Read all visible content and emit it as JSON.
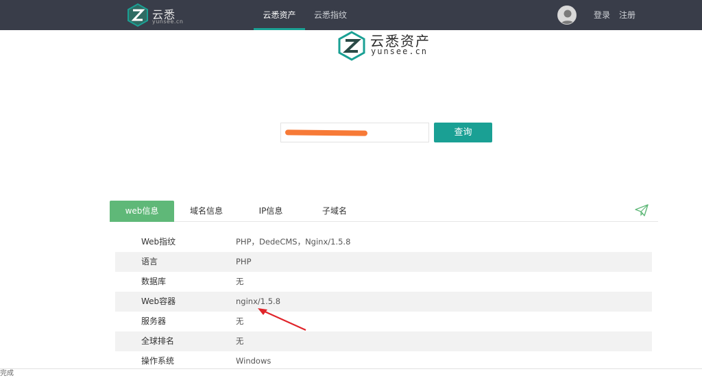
{
  "header": {
    "brand_cn": "云悉",
    "brand_en": "yunsee.cn",
    "nav": [
      {
        "label": "云悉资产",
        "active": true
      },
      {
        "label": "云悉指纹",
        "active": false
      }
    ],
    "login": "登录",
    "register": "注册"
  },
  "logo": {
    "cn": "云悉资产",
    "en": "yunsee.cn"
  },
  "search": {
    "value": "",
    "button": "查询"
  },
  "tabs": [
    {
      "label": "web信息",
      "active": true
    },
    {
      "label": "域名信息",
      "active": false
    },
    {
      "label": "IP信息",
      "active": false
    },
    {
      "label": "子域名",
      "active": false
    }
  ],
  "info_rows": [
    {
      "key": "Web指纹",
      "value": "PHP，DedeCMS，Nginx/1.5.8"
    },
    {
      "key": "语言",
      "value": "PHP"
    },
    {
      "key": "数据库",
      "value": "无"
    },
    {
      "key": "Web容器",
      "value": "nginx/1.5.8"
    },
    {
      "key": "服务器",
      "value": "无"
    },
    {
      "key": "全球排名",
      "value": "无"
    },
    {
      "key": "操作系统",
      "value": "Windows"
    }
  ],
  "status": "完成",
  "colors": {
    "topbar": "#393d49",
    "accent": "#1aa094",
    "tab_active": "#5fb878",
    "annotation": "#e0242a",
    "redaction": "#f7732c"
  }
}
